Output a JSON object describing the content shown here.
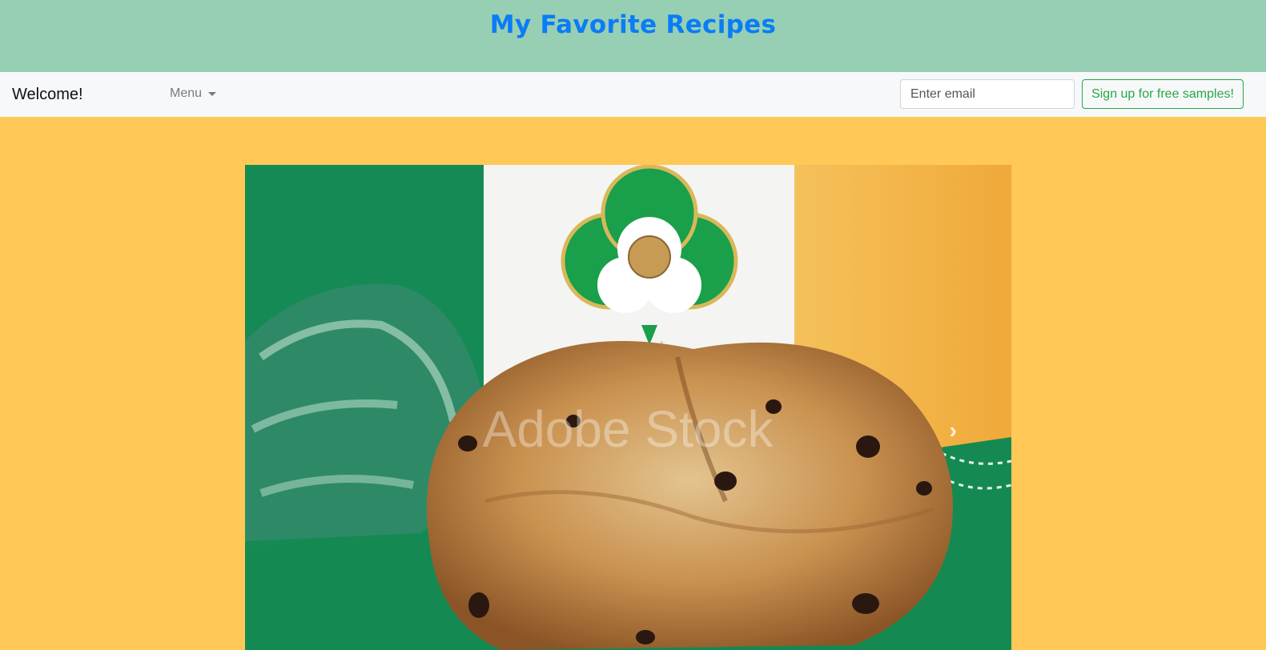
{
  "banner": {
    "title": "My Favorite Recipes"
  },
  "navbar": {
    "brand": "Welcome!",
    "menu_label": "Menu",
    "email_placeholder": "Enter email",
    "signup_label": "Sign up for free samples!"
  },
  "carousel": {
    "image_subject": "Irish soda bread with shamrock pick",
    "watermark": "Adobe Stock",
    "next_icon": "chevron-right-icon"
  },
  "colors": {
    "banner_bg": "#97cfb4",
    "title": "#0a7cf5",
    "page_bg": "#ffc857",
    "navbar_bg": "#f7f8fa",
    "signup_accent": "#28a745"
  }
}
